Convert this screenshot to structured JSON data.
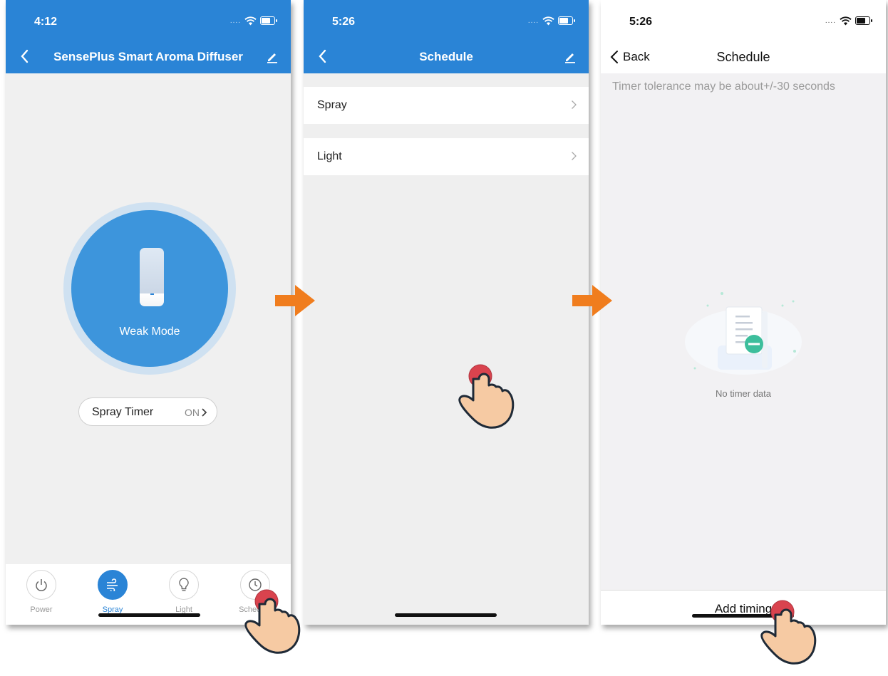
{
  "phone1": {
    "status_time": "4:12",
    "title": "SensePlus Smart Aroma Diffuser",
    "mode_label": "Weak Mode",
    "spray_timer_label": "Spray Timer",
    "spray_timer_value": "ON",
    "tabs": [
      {
        "label": "Power",
        "icon": "power-icon"
      },
      {
        "label": "Spray",
        "icon": "spray-icon",
        "active": true
      },
      {
        "label": "Light",
        "icon": "bulb-icon"
      },
      {
        "label": "Schedule",
        "icon": "clock-icon"
      }
    ]
  },
  "phone2": {
    "status_time": "5:26",
    "title": "Schedule",
    "rows": [
      "Spray",
      "Light"
    ]
  },
  "phone3": {
    "status_time": "5:26",
    "back_label": "Back",
    "title": "Schedule",
    "note": "Timer tolerance may be about+/-30 seconds",
    "empty_text": "No timer data",
    "add_label": "Add timing"
  },
  "colors": {
    "primary": "#2a84d6",
    "arrow": "#f07d1e",
    "tap_dot": "#d9434e",
    "hand": "#f6caa3"
  }
}
